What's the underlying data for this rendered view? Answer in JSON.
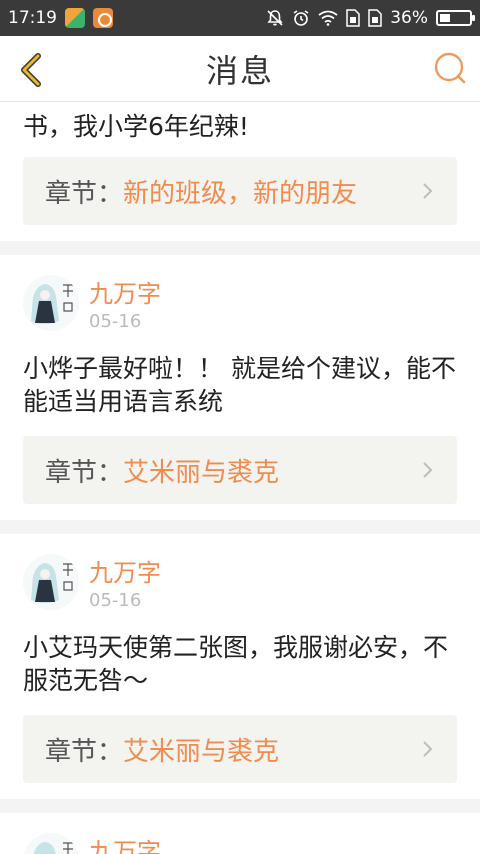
{
  "status_bar": {
    "time": "17:19",
    "battery_percent": "36%",
    "battery_level": 0.36
  },
  "nav": {
    "title": "消息"
  },
  "colors": {
    "accent": "#ef8c4f",
    "status_bg": "#3a3a3a",
    "back_icon": "#d8a623"
  },
  "messages": [
    {
      "content": "书，我小学6年纪辣!",
      "chapter_prefix": "章节：",
      "chapter_name": "新的班级，新的朋友"
    },
    {
      "username": "九万字",
      "date": "05-16",
      "content": "小烨子最好啦！！ 就是给个建议，能不能适当用语言系统",
      "chapter_prefix": "章节：",
      "chapter_name": "艾米丽与裘克"
    },
    {
      "username": "九万字",
      "date": "05-16",
      "content": "小艾玛天使第二张图，我服谢必安，不服范无咎～",
      "chapter_prefix": "章节：",
      "chapter_name": "艾米丽与裘克"
    },
    {
      "username": "九万字"
    }
  ]
}
